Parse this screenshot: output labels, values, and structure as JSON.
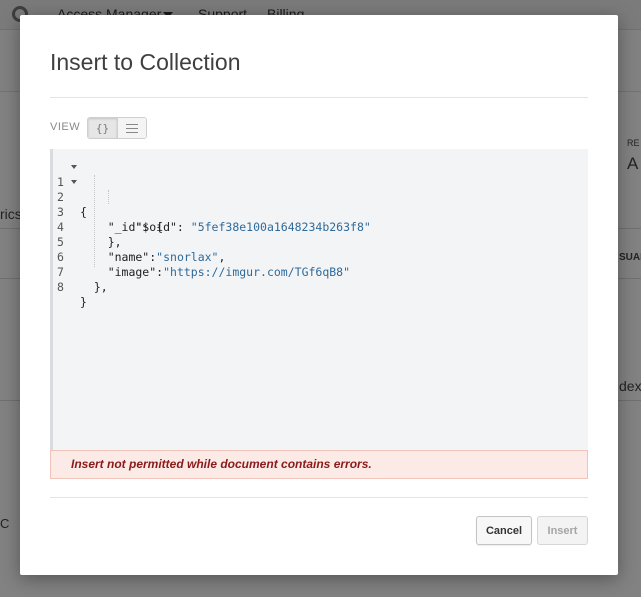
{
  "background": {
    "nav": [
      "Access Manager",
      "Support",
      "Billing"
    ],
    "fragments": [
      "RE",
      "A",
      "rics",
      "SUAL",
      "dex",
      "C"
    ]
  },
  "modal": {
    "title": "Insert to Collection",
    "view_label": "VIEW",
    "view_modes": [
      {
        "icon": "json-braces-icon",
        "glyph": "{}",
        "active": true
      },
      {
        "icon": "list-view-icon",
        "glyph": "",
        "active": false
      }
    ],
    "editor": {
      "lines": [
        {
          "n": "1",
          "text": "{",
          "fold": true
        },
        {
          "n": "2",
          "text": "    \"_id\": {",
          "fold": true
        },
        {
          "n": "3",
          "text": "        \"$oid\": ",
          "value": "\"5fef38e100a1648234b263f8\"",
          "fold": false
        },
        {
          "n": "4",
          "text": "    },",
          "fold": false
        },
        {
          "n": "5",
          "text": "    \"name\":",
          "value": "\"snorlax\"",
          "suffix": ",",
          "fold": false
        },
        {
          "n": "6",
          "text": "    \"image\":",
          "value": "\"https://imgur.com/TGf6qB8\"",
          "fold": false
        },
        {
          "n": "7",
          "text": "  },",
          "fold": false
        },
        {
          "n": "8",
          "text": "}",
          "fold": false
        }
      ]
    },
    "error_message": "Insert not permitted while document contains errors.",
    "buttons": {
      "cancel": "Cancel",
      "insert": "Insert"
    }
  },
  "colors": {
    "error_text": "#8b1a1a",
    "error_bg": "#fbeae5",
    "string_value": "#2f6a9a",
    "editor_bg": "#f3f4f6"
  }
}
